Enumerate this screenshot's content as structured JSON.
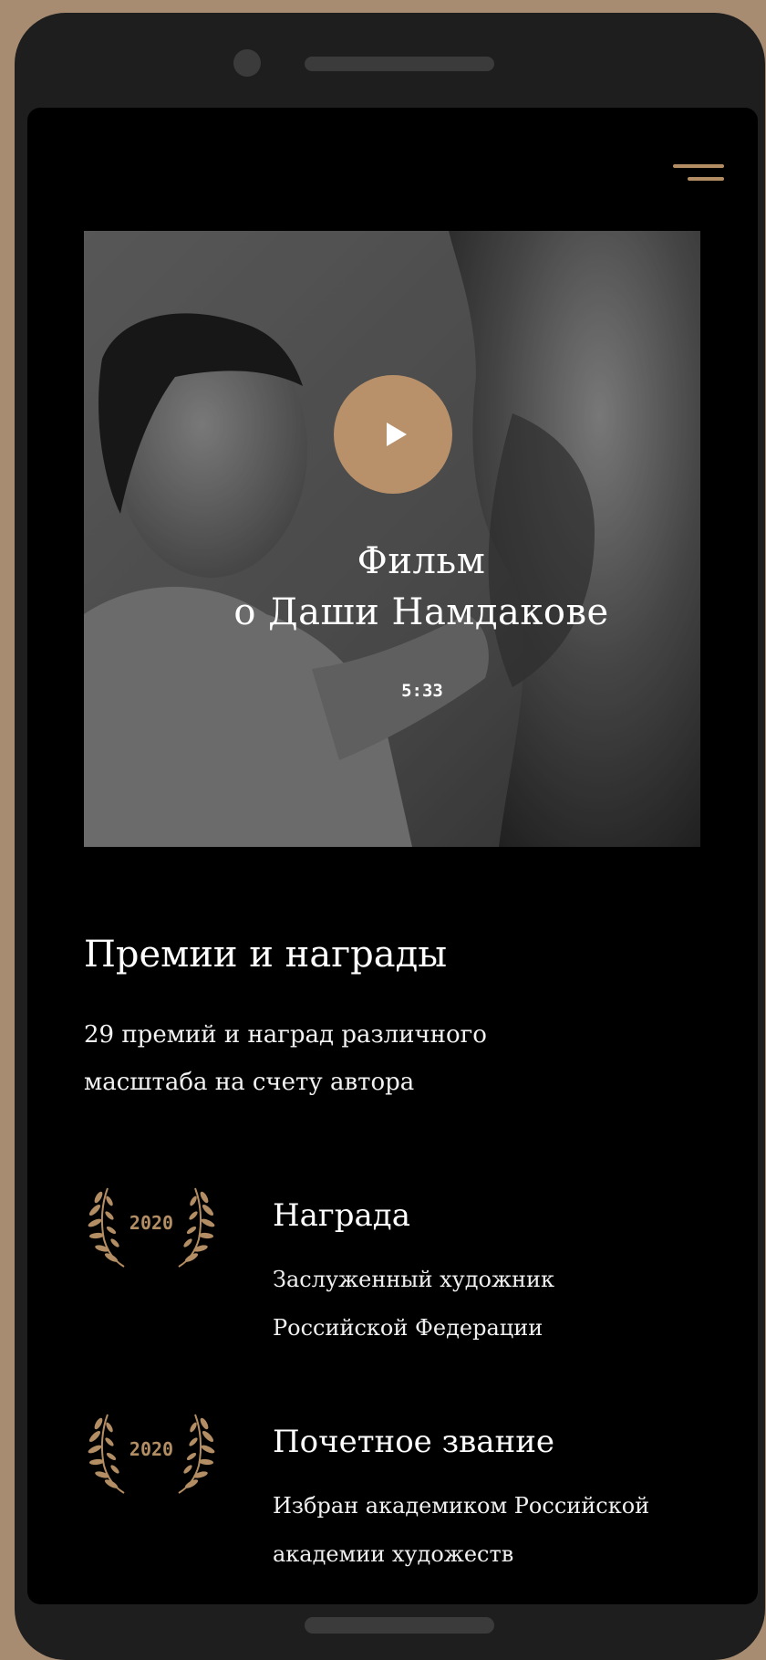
{
  "colors": {
    "accent": "#b38d63",
    "play_button": "#b8916a",
    "background": "#000000",
    "frame": "#a88c72",
    "device": "#1e1e1e"
  },
  "header": {
    "menu_icon": "hamburger-menu-icon"
  },
  "video": {
    "title_line1": "Фильм",
    "title_line2": "о Даши Намдакове",
    "duration": "5:33",
    "play_icon": "play-icon"
  },
  "awards_section": {
    "title": "Премии и награды",
    "description_line1": "29 премий и наград различного",
    "description_line2": "масштаба на счету автора",
    "items": [
      {
        "year": "2020",
        "title": "Награда",
        "desc_line1": "Заслуженный художник",
        "desc_line2": "Российской Федерации",
        "icon": "laurel-wreath-icon"
      },
      {
        "year": "2020",
        "title": "Почетное звание",
        "desc_line1": "Избран академиком Российской",
        "desc_line2": "академии художеств",
        "icon": "laurel-wreath-icon"
      }
    ]
  }
}
